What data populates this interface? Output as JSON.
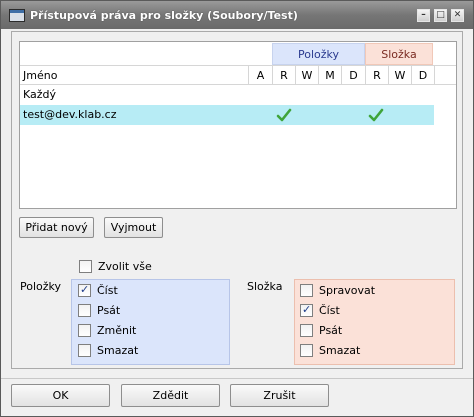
{
  "window": {
    "title": "Přístupová práva pro složky (Soubory/Test)",
    "controls": [
      "minimize",
      "maximize",
      "close"
    ]
  },
  "grid": {
    "groups": {
      "items": "Položky",
      "folder": "Složka"
    },
    "columns": [
      "Jméno",
      "A",
      "R",
      "W",
      "M",
      "D",
      "R",
      "W",
      "D"
    ],
    "rows": [
      {
        "name": "Každý",
        "selected": false,
        "items_read": false,
        "folder_read": false
      },
      {
        "name": "test@dev.klab.cz",
        "selected": true,
        "items_read": true,
        "folder_read": true
      }
    ]
  },
  "actions": {
    "add_new": "Přidat nový",
    "remove": "Vyjmout"
  },
  "select_all": {
    "label": "Zvolit vše",
    "checked": false
  },
  "items_section": {
    "label": "Položky",
    "options": [
      {
        "label": "Číst",
        "checked": true
      },
      {
        "label": "Psát",
        "checked": false
      },
      {
        "label": "Změnit",
        "checked": false
      },
      {
        "label": "Smazat",
        "checked": false
      }
    ]
  },
  "folder_section": {
    "label": "Složka",
    "options": [
      {
        "label": "Spravovat",
        "checked": false
      },
      {
        "label": "Číst",
        "checked": true
      },
      {
        "label": "Psát",
        "checked": false
      },
      {
        "label": "Smazat",
        "checked": false
      }
    ]
  },
  "footer": {
    "ok": "OK",
    "inherit": "Zdědit",
    "cancel": "Zrušit"
  },
  "colors": {
    "items_group_bg": "#dbe5fb",
    "folder_group_bg": "#fbe1d8",
    "selected_row_bg": "#b7ecf5",
    "check_green": "#3fa43a"
  }
}
